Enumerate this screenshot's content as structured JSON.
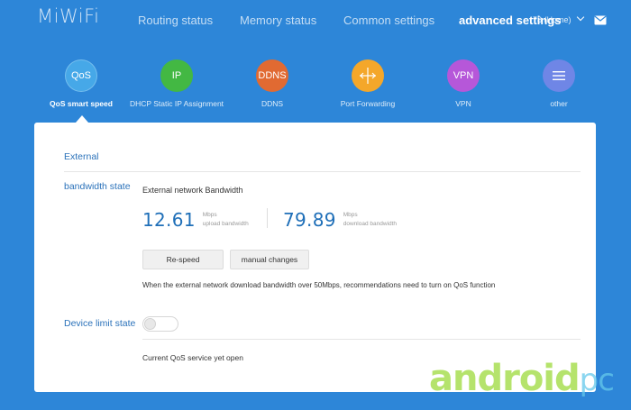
{
  "brand": {
    "logo": "MiWiFi"
  },
  "nav": {
    "items": [
      {
        "label": "Routing status"
      },
      {
        "label": "Memory status"
      },
      {
        "label": "Common settings"
      },
      {
        "label": "advanced settings"
      }
    ],
    "router_name": "78 (Home)"
  },
  "features": [
    {
      "icon_text": "QoS",
      "label": "QoS smart speed",
      "color": "#46a8e8"
    },
    {
      "icon_text": "IP",
      "label": "DHCP Static IP Assignment",
      "color": "#43b843"
    },
    {
      "icon_text": "DDNS",
      "label": "DDNS",
      "color": "#e16a32"
    },
    {
      "icon_text": "",
      "label": "Port Forwarding",
      "color": "#f4a72a"
    },
    {
      "icon_text": "VPN",
      "label": "VPN",
      "color": "#b657d9"
    },
    {
      "icon_text": "",
      "label": "other",
      "color": "#6f86e6"
    }
  ],
  "panel": {
    "external_title": "External",
    "bandwidth_title": "bandwidth state",
    "ext_bw_label": "External network Bandwidth",
    "upload": {
      "value": "12.61",
      "unit": "Mbps",
      "desc": "upload bandwidth"
    },
    "download": {
      "value": "79.89",
      "unit": "Mbps",
      "desc": "download bandwidth"
    },
    "respeed_button": "Re-speed",
    "manual_button": "manual changes",
    "hint": "When the external network download bandwidth over 50Mbps, recommendations need to turn on QoS function",
    "device_limit_title": "Device limit state",
    "device_limit_on": false,
    "qos_status": "Current QoS service yet open"
  },
  "watermark": {
    "part1": "android",
    "part2": "pc"
  }
}
